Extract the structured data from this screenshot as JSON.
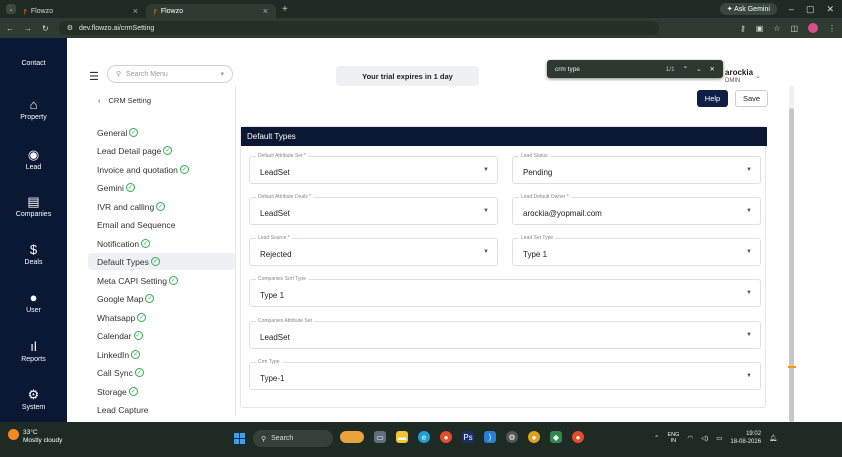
{
  "browser": {
    "tabs": [
      {
        "title": "Flowzo",
        "active": false
      },
      {
        "title": "Flowzo",
        "active": true
      }
    ],
    "new_tab": "+",
    "gemini_label": "Ask Gemini",
    "url": "dev.flowzo.ai/crmSetting"
  },
  "find_bar": {
    "query": "crm type",
    "count": "1/1"
  },
  "sidebar": {
    "items": [
      {
        "label": "Contact",
        "icon": "contact-icon"
      },
      {
        "label": "Property",
        "icon": "home-icon"
      },
      {
        "label": "Lead",
        "icon": "user-circle-icon"
      },
      {
        "label": "Companies",
        "icon": "building-icon"
      },
      {
        "label": "Deals",
        "icon": "dollar-icon"
      },
      {
        "label": "User",
        "icon": "user-icon"
      },
      {
        "label": "Reports",
        "icon": "bar-chart-icon"
      },
      {
        "label": "System",
        "icon": "gear-icon"
      }
    ]
  },
  "header": {
    "search_placeholder": "Search Menu",
    "trial_text": "Your trial expires in 1 day",
    "user_name": "arockia",
    "user_role": "DMIN"
  },
  "settings_nav": {
    "back_label": "CRM Setting",
    "items": [
      {
        "label": "General",
        "checked": true,
        "active": false
      },
      {
        "label": "Lead Detail page",
        "checked": true,
        "active": false
      },
      {
        "label": "Invoice and quotation",
        "checked": true,
        "active": false
      },
      {
        "label": "Gemini",
        "checked": true,
        "active": false
      },
      {
        "label": "IVR and calling",
        "checked": true,
        "active": false
      },
      {
        "label": "Email and Sequence",
        "checked": false,
        "active": false
      },
      {
        "label": "Notification",
        "checked": true,
        "active": false
      },
      {
        "label": "Default Types",
        "checked": true,
        "active": true
      },
      {
        "label": "Meta CAPI Setting",
        "checked": true,
        "active": false
      },
      {
        "label": "Google Map",
        "checked": true,
        "active": false
      },
      {
        "label": "Whatsapp",
        "checked": true,
        "active": false
      },
      {
        "label": "Calendar",
        "checked": true,
        "active": false
      },
      {
        "label": "LinkedIn",
        "checked": true,
        "active": false
      },
      {
        "label": "Call Sync",
        "checked": true,
        "active": false
      },
      {
        "label": "Storage",
        "checked": true,
        "active": false
      },
      {
        "label": "Lead Capture",
        "checked": false,
        "active": false
      }
    ]
  },
  "actions": {
    "help_label": "Help",
    "save_label": "Save"
  },
  "default_types": {
    "title": "Default Types",
    "fields": [
      {
        "label": "Default Attribute Set *",
        "value": "LeadSet"
      },
      {
        "label": "Lead Status",
        "value": "Pending"
      },
      {
        "label": "Default Attribute Deals *",
        "value": "LeadSet"
      },
      {
        "label": "Lead Default Owner *",
        "value": "arockia@yopmail.com"
      },
      {
        "label": "Lead Source *",
        "value": "Rejected"
      },
      {
        "label": "Lead Set Type",
        "value": "Type 1"
      },
      {
        "label": "Companies Sort Type",
        "value": "Type 1"
      },
      {
        "label": "Companies Attribute Set",
        "value": "LeadSet"
      },
      {
        "label": "Crm Type",
        "value": "Type-1"
      }
    ]
  },
  "taskbar": {
    "weather_temp": "33°C",
    "weather_desc": "Mostly cloudy",
    "search_label": "Search",
    "lang_top": "ENG",
    "lang_bottom": "IN",
    "time": "19:02",
    "date": "18-08-2026"
  },
  "colors": {
    "sidebar_bg": "#0a1833",
    "header_bar_bg": "#0a1833",
    "check_green": "#2eae4f",
    "find_highlight": "#ff9800"
  }
}
